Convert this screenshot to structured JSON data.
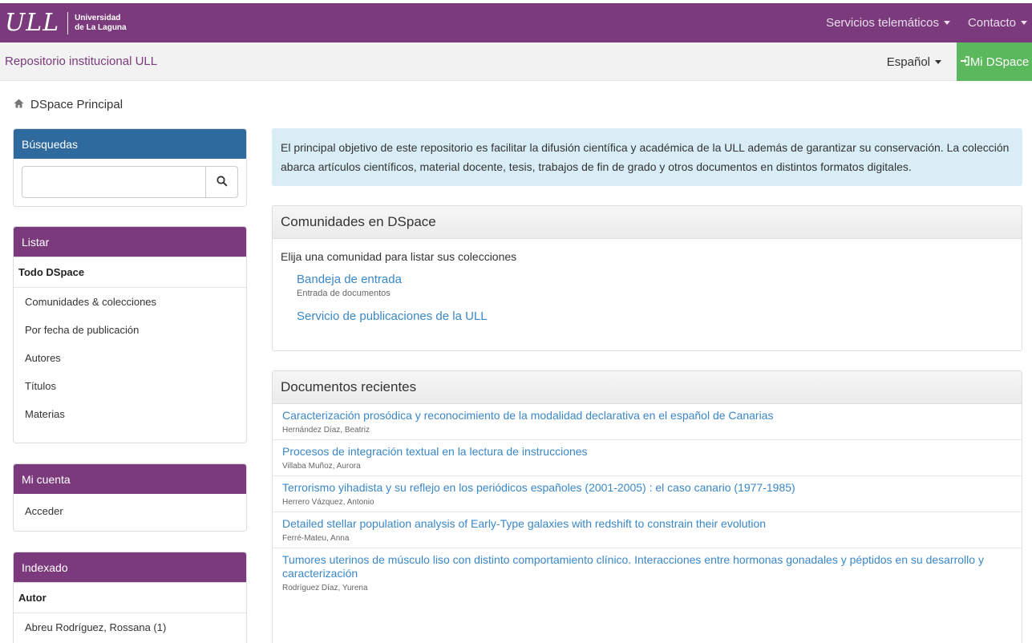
{
  "header": {
    "logo_mark": "ULL",
    "logo_line1": "Universidad",
    "logo_line2": "de La Laguna",
    "nav": [
      {
        "label": "Servicios telemáticos"
      },
      {
        "label": "Contacto"
      }
    ]
  },
  "subbar": {
    "title": "Repositorio institucional ULL",
    "language": "Español",
    "mydspace": "Mi DSpace"
  },
  "breadcrumb": {
    "label": "DSpace Principal"
  },
  "sidebar": {
    "search": {
      "title": "Búsquedas",
      "placeholder": ""
    },
    "browse": {
      "title": "Listar",
      "section": "Todo DSpace",
      "items": [
        {
          "label": "Comunidades & colecciones"
        },
        {
          "label": "Por fecha de publicación"
        },
        {
          "label": "Autores"
        },
        {
          "label": "Títulos"
        },
        {
          "label": "Materias"
        }
      ]
    },
    "account": {
      "title": "Mi cuenta",
      "items": [
        {
          "label": "Acceder"
        }
      ]
    },
    "index": {
      "title": "Indexado",
      "section": "Autor",
      "items": [
        {
          "label": "Abreu Rodríguez, Rossana (1)"
        }
      ]
    }
  },
  "intro": {
    "text": "El principal objetivo de este repositorio es facilitar la difusión científica y académica de la ULL además de garantizar su conservación. La colección abarca artículos científicos, material docente, tesis, trabajos de fin de grado y otros documentos en distintos formatos digitales."
  },
  "communities": {
    "title": "Comunidades en DSpace",
    "lead": "Elija una comunidad para listar sus colecciones",
    "items": [
      {
        "name": "Bandeja de entrada",
        "desc": "Entrada de documentos"
      },
      {
        "name": "Servicio de publicaciones de la ULL",
        "desc": ""
      }
    ]
  },
  "recent": {
    "title": "Documentos recientes",
    "items": [
      {
        "title": "Caracterización prosódica y reconocimiento de la modalidad declarativa en el español de Canarias",
        "author": "Hernández Díaz, Beatriz"
      },
      {
        "title": "Procesos de integración textual en la lectura de instrucciones",
        "author": "Villaba Muñoz, Aurora"
      },
      {
        "title": "Terrorismo yihadista y su reflejo en los periódicos españoles (2001-2005) : el caso canario (1977-1985)",
        "author": "Herrero Vázquez, Antonio"
      },
      {
        "title": "Detailed stellar population analysis of Early-Type galaxies with redshift to constrain their evolution",
        "author": "Ferré-Mateu, Anna"
      },
      {
        "title": "Tumores uterinos de músculo liso con distinto comportamiento clínico. Interacciones entre hormonas gonadales y péptidos en su desarrollo y caracterización",
        "author": "Rodríguez Díaz, Yurena"
      }
    ]
  },
  "colors": {
    "brand_purple": "#7b3a7c",
    "panel_blue": "#2f6a9f",
    "success_green": "#5cb85c",
    "link_blue": "#3a87c8",
    "info_bg": "#d9edf7"
  }
}
